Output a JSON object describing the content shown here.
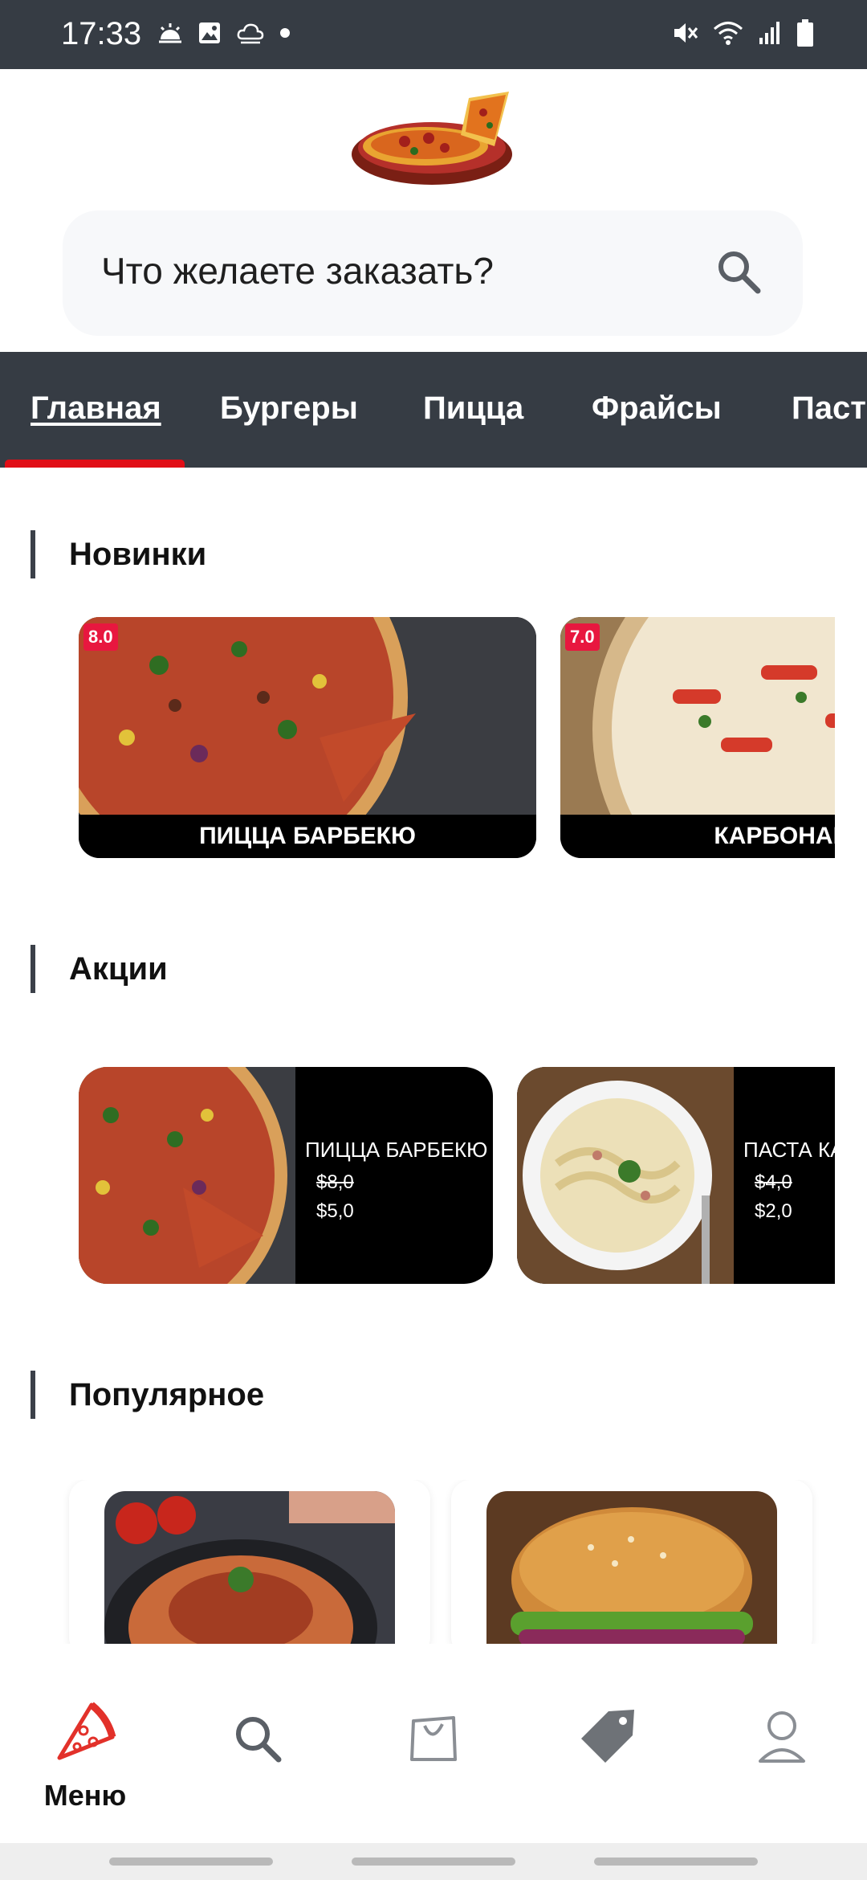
{
  "status_bar": {
    "time": "17:33",
    "left_icons": [
      "weather-sunrise-icon",
      "image-icon",
      "weather-cloud-icon",
      "dot-icon"
    ],
    "right_icons": [
      "mute-icon",
      "wifi-icon",
      "signal-icon",
      "battery-icon"
    ]
  },
  "header": {
    "logo": "pizza-logo-icon",
    "search_placeholder": "Что желаете заказать?"
  },
  "tabs": [
    {
      "label": "Главная",
      "active": true
    },
    {
      "label": "Бургеры",
      "active": false
    },
    {
      "label": "Пицца",
      "active": false
    },
    {
      "label": "Фрайсы",
      "active": false
    },
    {
      "label": "Паста",
      "active": false
    }
  ],
  "sections": {
    "new": {
      "title": "Новинки",
      "items": [
        {
          "rating": "8.0",
          "name": "ПИЦЦА БАРБЕКЮ"
        },
        {
          "rating": "7.0",
          "name": "КАРБОНАРА"
        }
      ]
    },
    "promos": {
      "title": "Акции",
      "items": [
        {
          "name": "ПИЦЦА БАРБЕКЮ",
          "old_price": "$8,0",
          "new_price": "$5,0"
        },
        {
          "name": "ПАСТА КАРБОНАРА",
          "old_price": "$4,0",
          "new_price": "$2,0"
        }
      ]
    },
    "popular": {
      "title": "Популярное",
      "items": [
        {
          "image": "pasta-bolognese"
        },
        {
          "image": "burger"
        }
      ]
    }
  },
  "bottom_nav": {
    "items": [
      {
        "icon": "pizza-icon",
        "label": "Меню",
        "active": true
      },
      {
        "icon": "search-icon",
        "label": ""
      },
      {
        "icon": "bag-icon",
        "label": ""
      },
      {
        "icon": "tag-icon",
        "label": ""
      },
      {
        "icon": "profile-icon",
        "label": ""
      }
    ]
  },
  "colors": {
    "bar_bg": "#363c44",
    "accent_red": "#e10e17",
    "rating_bg": "#e8173f"
  }
}
